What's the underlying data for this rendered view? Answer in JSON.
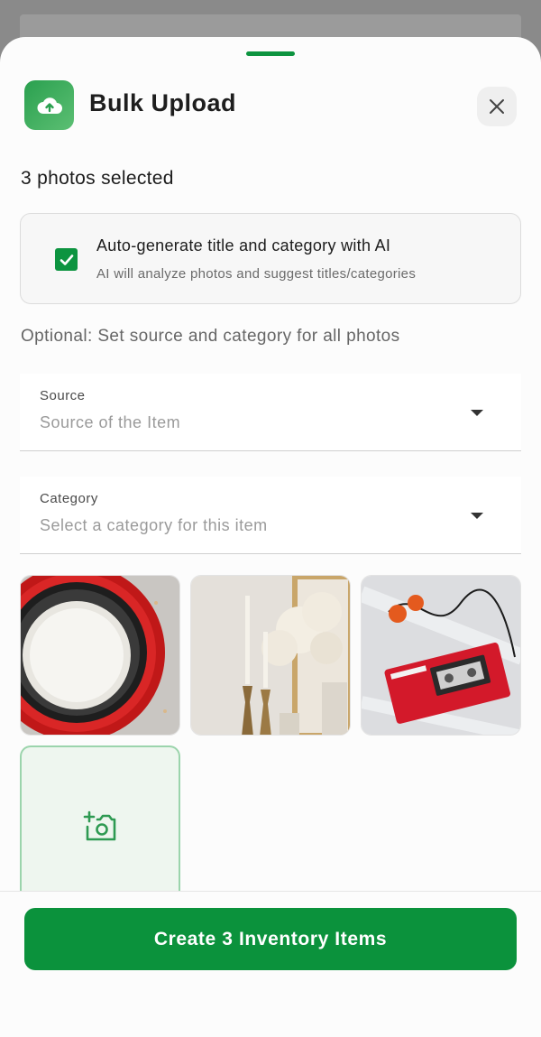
{
  "sheet": {
    "title": "Bulk Upload",
    "selected_count_text": "3 photos selected"
  },
  "ai_option": {
    "checked": true,
    "title": "Auto-generate title and category with AI",
    "subtitle": "AI will analyze photos and suggest titles/categories"
  },
  "optional_text": "Optional: Set source and category for all photos",
  "fields": {
    "source": {
      "label": "Source",
      "placeholder": "Source of the Item"
    },
    "category": {
      "label": "Category",
      "placeholder": "Select a category for this item"
    }
  },
  "photos": [
    {
      "subject": "stacked red and black bowls"
    },
    {
      "subject": "candlesticks with dried flowers"
    },
    {
      "subject": "red walkman cassette player"
    }
  ],
  "actions": {
    "create_button": "Create 3 Inventory Items"
  },
  "icons": {
    "header": "cloud-upload-icon",
    "close": "close-icon",
    "checkbox": "check-icon",
    "add_photo": "add-camera-icon"
  },
  "colors": {
    "accent": "#0b923c",
    "accent_light": "#eef6ef"
  }
}
